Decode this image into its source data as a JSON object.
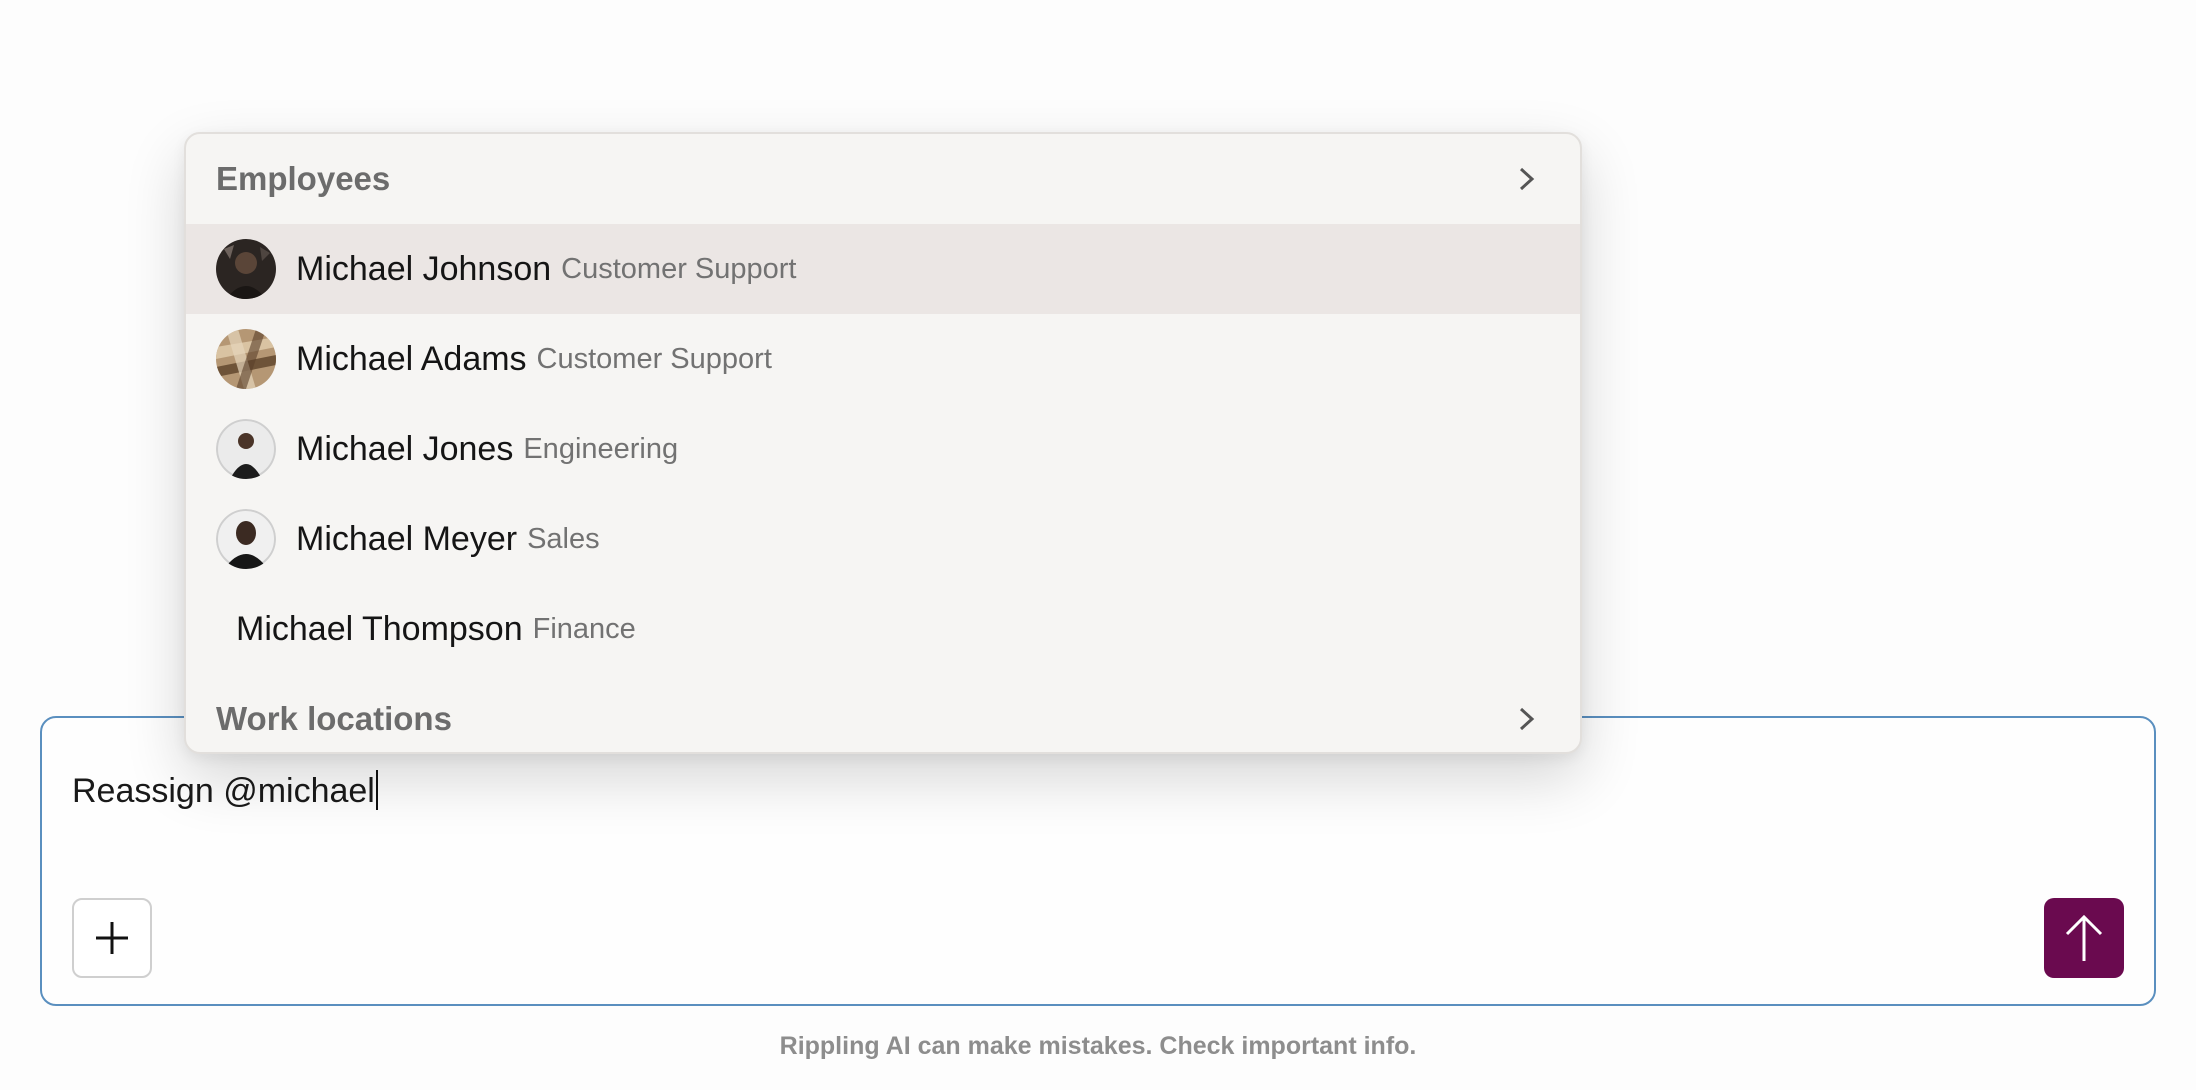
{
  "dropdown": {
    "employees_header": "Employees",
    "employees": [
      {
        "name": "Michael Johnson",
        "department": "Customer Support",
        "avatar": "photo-dark"
      },
      {
        "name": "Michael Adams",
        "department": "Customer Support",
        "avatar": "photo-wood"
      },
      {
        "name": "Michael Jones",
        "department": "Engineering",
        "avatar": "photo-person-light"
      },
      {
        "name": "Michael Meyer",
        "department": "Sales",
        "avatar": "photo-person-dark"
      },
      {
        "name": "Michael Thompson",
        "department": "Finance",
        "avatar": "none"
      }
    ],
    "work_locations_header": "Work locations",
    "highlighted_index": 0
  },
  "composer": {
    "text": "Reassign @michael",
    "add_icon": "plus-icon",
    "send_icon": "arrow-up-icon"
  },
  "footer": {
    "disclaimer": "Rippling AI can make mistakes. Check important info."
  },
  "colors": {
    "send_button": "#6a0a4f",
    "composer_border": "#5a8fbf",
    "highlight_row": "#ebe6e4",
    "dropdown_bg": "#f6f5f3"
  }
}
